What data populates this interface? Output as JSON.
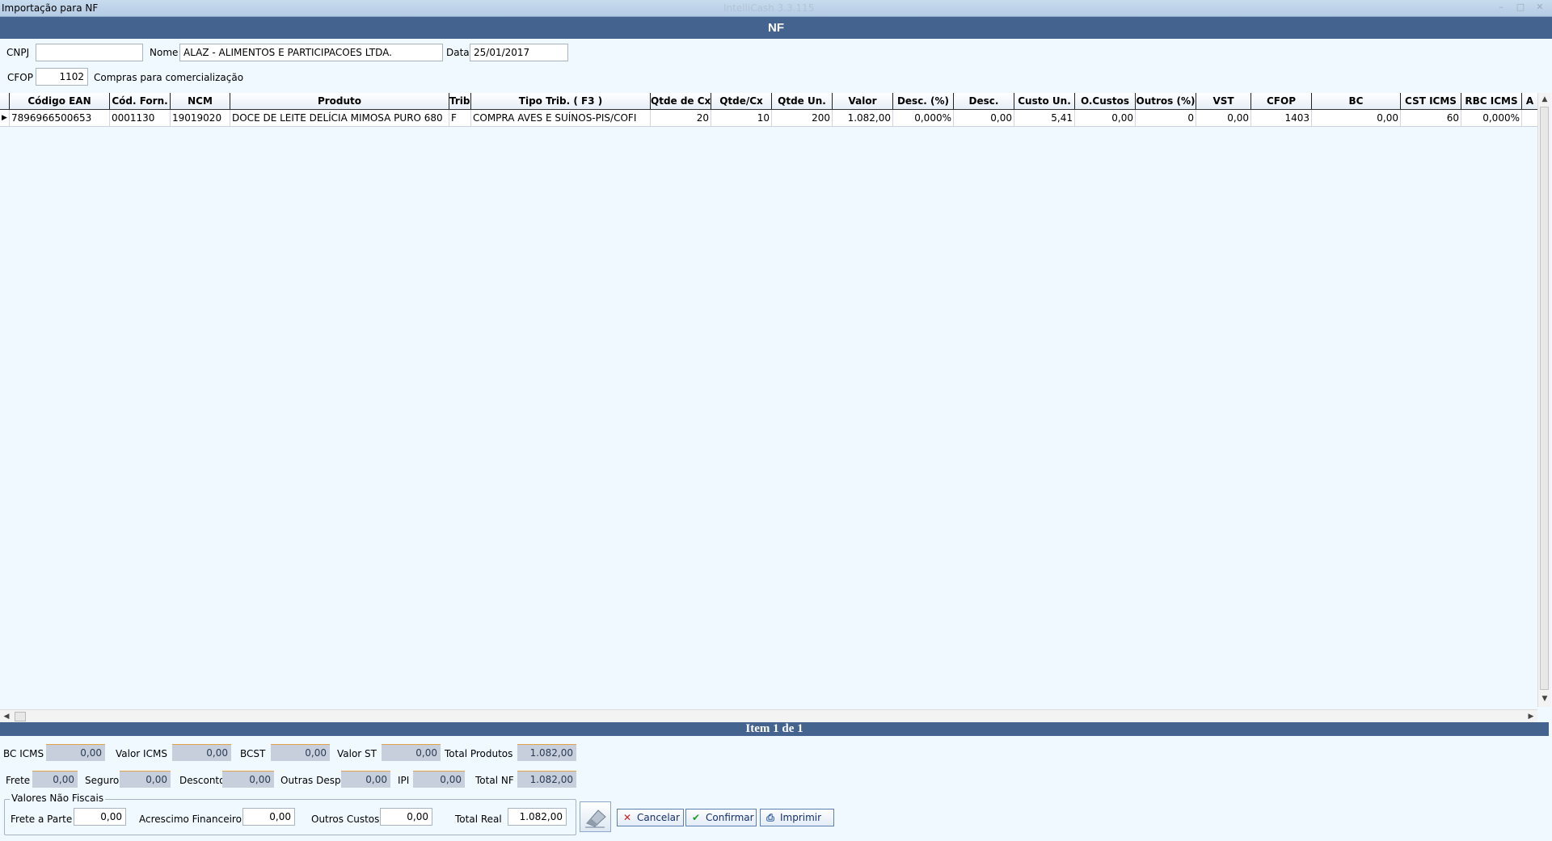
{
  "window": {
    "title": "Importação para NF",
    "app_title": "IntelliCash 3.3.115"
  },
  "header": {
    "title": "NF"
  },
  "form": {
    "cnpj_label": "CNPJ",
    "cnpj_value": "",
    "nome_label": "Nome",
    "nome_value": "ALAZ - ALIMENTOS E PARTICIPACOES LTDA.",
    "data_label": "Data",
    "data_value": "25/01/2017",
    "cfop_label": "CFOP",
    "cfop_value": "1102",
    "cfop_desc": "Compras para comercialização"
  },
  "grid": {
    "columns": [
      "Código EAN",
      "Cód. Forn.",
      "NCM",
      "Produto",
      "Trib.",
      "Tipo Trib. ( F3 )",
      "Qtde de Cxs",
      "Qtde/Cx",
      "Qtde Un.",
      "Valor",
      "Desc. (%)",
      "Desc.",
      "Custo Un.",
      "O.Custos",
      "Outros (%)",
      "VST",
      "CFOP",
      "BC",
      "CST ICMS",
      "RBC ICMS",
      "A"
    ],
    "rows": [
      [
        "7896966500653",
        "0001130",
        "19019020",
        "DOCE DE LEITE DELÍCIA MIMOSA PURO 680",
        "F",
        "COMPRA AVES E SUÍNOS-PIS/COFI",
        "20",
        "10",
        "200",
        "1.082,00",
        "0,000%",
        "0,00",
        "5,41",
        "0,00",
        "0",
        "0,00",
        "1403",
        "0,00",
        "60",
        "0,000%",
        ""
      ]
    ]
  },
  "status": {
    "item_text": "Item 1 de 1"
  },
  "totals": {
    "bc_icms_label": "BC ICMS",
    "bc_icms": "0,00",
    "valor_icms_label": "Valor ICMS",
    "valor_icms": "0,00",
    "bcst_label": "BCST",
    "bcst": "0,00",
    "valor_st_label": "Valor ST",
    "valor_st": "0,00",
    "total_produtos_label": "Total Produtos",
    "total_produtos": "1.082,00",
    "frete_label": "Frete",
    "frete": "0,00",
    "seguro_label": "Seguro",
    "seguro": "0,00",
    "desconto_label": "Desconto",
    "desconto": "0,00",
    "outras_desp_label": "Outras Desp.",
    "outras_desp": "0,00",
    "ipi_label": "IPI",
    "ipi": "0,00",
    "total_nf_label": "Total NF",
    "total_nf": "1.082,00"
  },
  "nao_fiscais": {
    "legend": "Valores Não Fiscais",
    "frete_parte_label": "Frete a Parte",
    "frete_parte": "0,00",
    "acrescimo_label": "Acrescimo Financeiro",
    "acrescimo": "0,00",
    "outros_custos_label": "Outros Custos",
    "outros_custos": "0,00",
    "total_real_label": "Total Real",
    "total_real": "1.082,00"
  },
  "buttons": {
    "cancelar": "Cancelar",
    "confirmar": "Confirmar",
    "imprimir": "Imprimir"
  }
}
